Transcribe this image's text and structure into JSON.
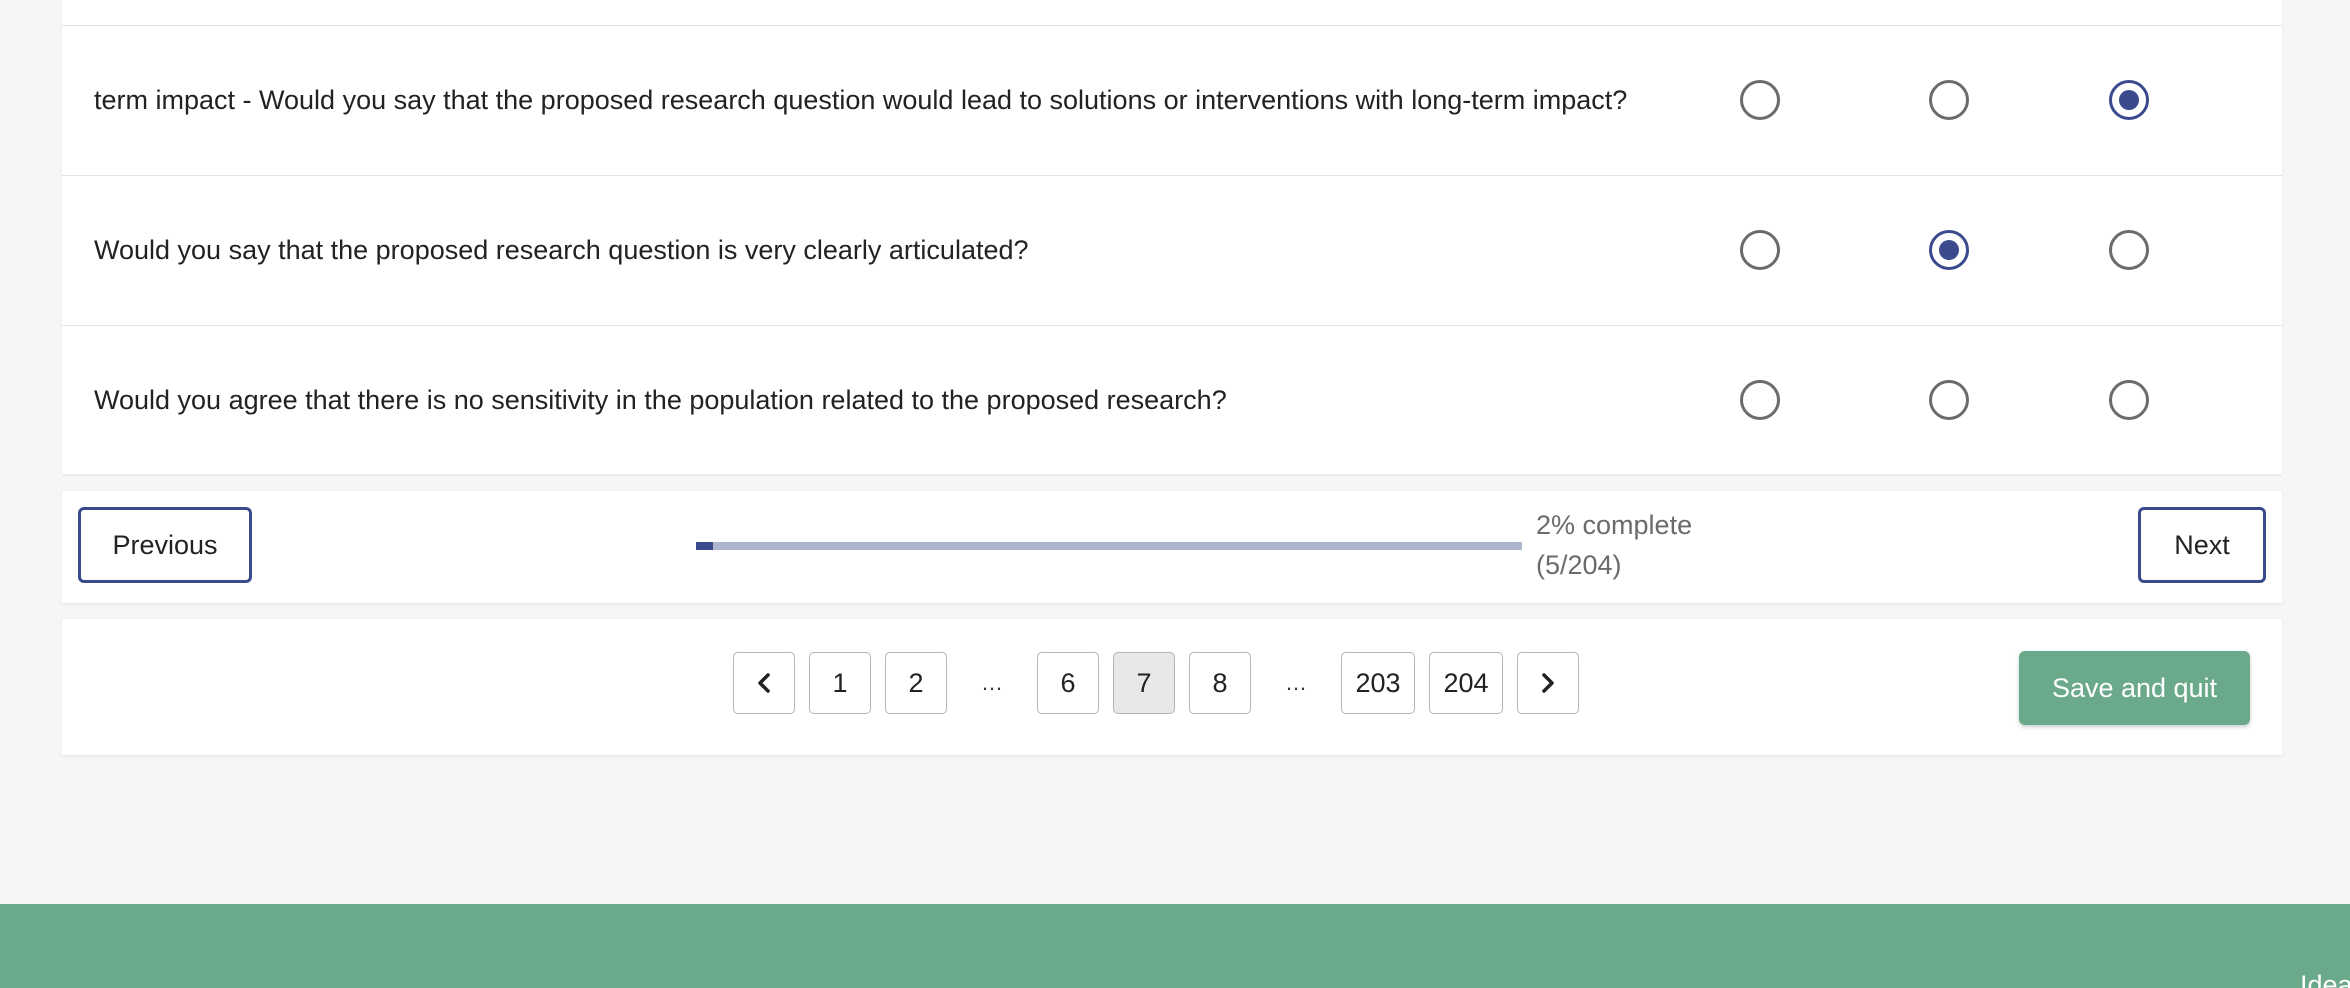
{
  "questions": [
    {
      "text": "term impact - Would you say that the proposed research question would lead to solutions or interventions with long-term impact?",
      "selected": 3
    },
    {
      "text": "Would you say that the proposed research question is very clearly articulated?",
      "selected": 2
    },
    {
      "text": "Would you agree that there is no sensitivity in the population related to the proposed research?",
      "selected": null
    }
  ],
  "navigation": {
    "previous_label": "Previous",
    "next_label": "Next",
    "progress_percent": 2,
    "progress_line1": "2% complete",
    "progress_line2": "(5/204)"
  },
  "pagination": {
    "prev_icon": "chevron-left-icon",
    "next_icon": "chevron-right-icon",
    "pages": [
      "1",
      "2",
      "…",
      "6",
      "7",
      "8",
      "…",
      "203",
      "204"
    ],
    "current": "7",
    "ellipsis": "…"
  },
  "actions": {
    "save_quit_label": "Save and quit"
  },
  "footer": {
    "text": "Idea"
  },
  "colors": {
    "accent": "#3a4a8c",
    "brand_green": "#6ba98b",
    "progress_track": "#aeb6cd"
  }
}
